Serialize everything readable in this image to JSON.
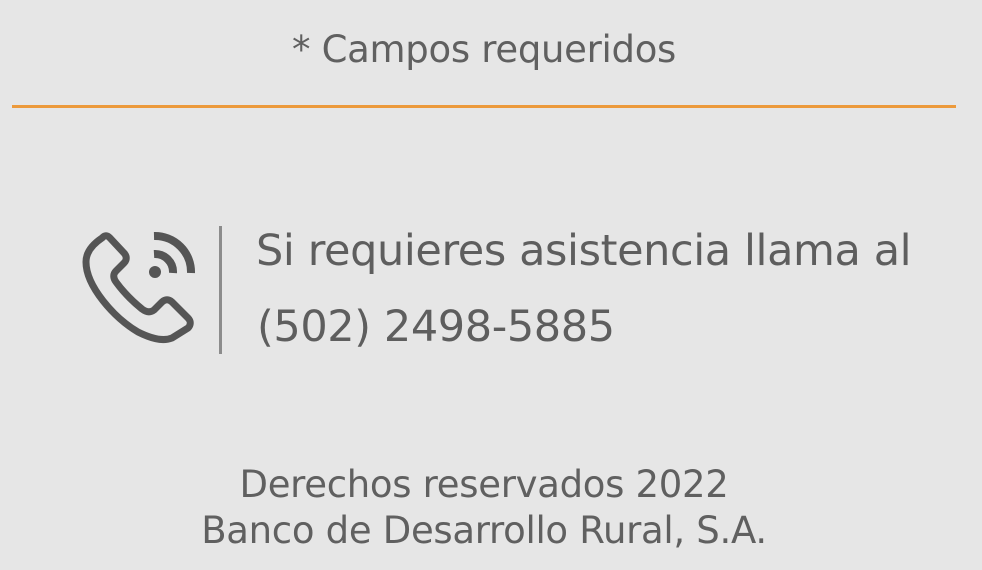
{
  "form": {
    "required_note": "* Campos requeridos"
  },
  "support": {
    "icon": "phone-ringing-icon",
    "line1": "Si requieres asistencia llama al",
    "phone": "(502) 2498-5885"
  },
  "footer": {
    "rights": "Derechos reservados 2022",
    "company": "Banco de Desarrollo Rural, S.A."
  },
  "colors": {
    "background": "#e6e6e6",
    "accent": "#ec9a3c",
    "text": "#5e5e5e"
  }
}
